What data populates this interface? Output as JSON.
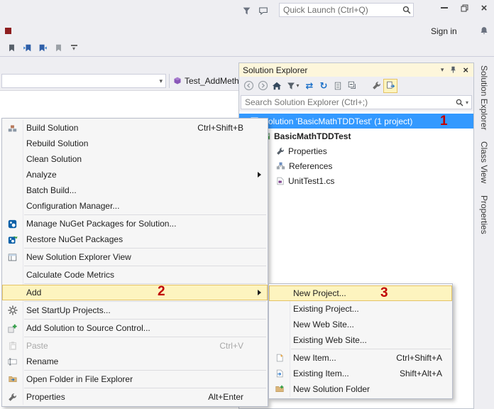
{
  "window": {
    "quick_launch": {
      "placeholder": "Quick Launch (Ctrl+Q)"
    },
    "sign_in_label": "Sign in"
  },
  "navbar": {
    "member_label": "Test_AddMeth..."
  },
  "solution_explorer": {
    "title": "Solution Explorer",
    "search_placeholder": "Search Solution Explorer (Ctrl+;)",
    "tree": [
      {
        "label": "Solution 'BasicMathTDDTest' (1 project)"
      },
      {
        "label": "BasicMathTDDTest"
      },
      {
        "label": "Properties"
      },
      {
        "label": "References"
      },
      {
        "label": "UnitTest1.cs"
      }
    ]
  },
  "side_tabs": [
    {
      "label": "Solution Explorer"
    },
    {
      "label": "Class View"
    },
    {
      "label": "Properties"
    }
  ],
  "context_menu": {
    "items": [
      {
        "label": "Build Solution",
        "shortcut": "Ctrl+Shift+B"
      },
      {
        "label": "Rebuild Solution"
      },
      {
        "label": "Clean Solution"
      },
      {
        "label": "Analyze"
      },
      {
        "label": "Batch Build..."
      },
      {
        "label": "Configuration Manager..."
      },
      {
        "label": "Manage NuGet Packages for Solution..."
      },
      {
        "label": "Restore NuGet Packages"
      },
      {
        "label": "New Solution Explorer View"
      },
      {
        "label": "Calculate Code Metrics"
      },
      {
        "label": "Add"
      },
      {
        "label": "Set StartUp Projects..."
      },
      {
        "label": "Add Solution to Source Control..."
      },
      {
        "label": "Paste",
        "shortcut": "Ctrl+V"
      },
      {
        "label": "Rename"
      },
      {
        "label": "Open Folder in File Explorer"
      },
      {
        "label": "Properties",
        "shortcut": "Alt+Enter"
      }
    ]
  },
  "add_submenu": {
    "items": [
      {
        "label": "New Project..."
      },
      {
        "label": "Existing Project..."
      },
      {
        "label": "New Web Site..."
      },
      {
        "label": "Existing Web Site..."
      },
      {
        "label": "New Item...",
        "shortcut": "Ctrl+Shift+A"
      },
      {
        "label": "Existing Item...",
        "shortcut": "Shift+Alt+A"
      },
      {
        "label": "New Solution Folder"
      }
    ]
  },
  "annotations": {
    "step1": "1",
    "step2": "2",
    "step3": "3"
  },
  "colors": {
    "selection_blue": "#3399FF",
    "menu_highlight": "#FDF4BF",
    "menu_highlight_border": "#E5C365",
    "annotation_red": "#C00000",
    "window_bg": "#EEEEF2",
    "panel_header_gold": "#FDF6DB"
  }
}
